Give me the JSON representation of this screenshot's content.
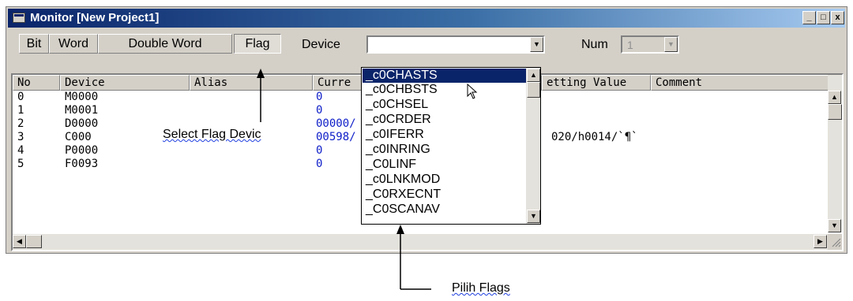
{
  "window": {
    "title": "Monitor [New Project1]",
    "minimize": "_",
    "maximize": "□",
    "close": "x"
  },
  "toolbar": {
    "tabs": [
      "Bit",
      "Word",
      "Double Word",
      "Flag"
    ],
    "active_tab": "Flag",
    "device_label": "Device",
    "device_value": "",
    "num_label": "Num",
    "num_value": "1"
  },
  "table": {
    "headers": [
      "No",
      "Device",
      "Alias",
      "Curre",
      "etting Value",
      "Comment"
    ],
    "rows": [
      {
        "no": "0",
        "device": "M0000",
        "current": "0",
        "setting": ""
      },
      {
        "no": "1",
        "device": "M0001",
        "current": "0",
        "setting": ""
      },
      {
        "no": "2",
        "device": "D0000",
        "current": "00000/",
        "setting": ""
      },
      {
        "no": "3",
        "device": "C000",
        "current": "00598/",
        "setting": "020/h0014/`¶`"
      },
      {
        "no": "4",
        "device": "P0000",
        "current": "0",
        "setting": ""
      },
      {
        "no": "5",
        "device": "F0093",
        "current": "0",
        "setting": ""
      }
    ]
  },
  "dropdown": {
    "items": [
      "_c0CHASTS",
      "_c0CHBSTS",
      "_c0CHSEL",
      "_c0CRDER",
      "_c0IFERR",
      "_c0INRING",
      "_C0LINF",
      "_c0LNKMOD",
      "_C0RXECNT",
      "_C0SCANAV"
    ],
    "selected_index": 0
  },
  "annotations": {
    "select_flag": "Select Flag Devic",
    "pilih_flags": "Pilih Flags"
  },
  "colors": {
    "title_start": "#0a246a",
    "title_end": "#a6caf0",
    "highlight": "#0a246a",
    "value_blue": "#1020c8"
  }
}
